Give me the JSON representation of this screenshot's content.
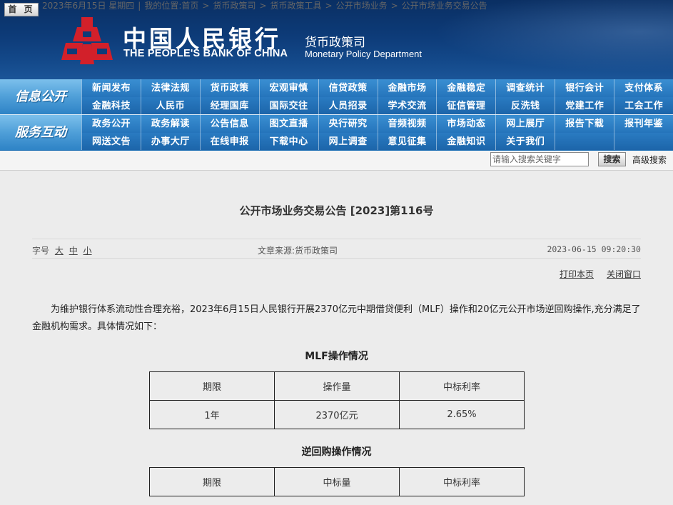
{
  "header": {
    "logo_cn": "中国人民银行",
    "logo_en": "THE PEOPLE'S BANK OF CHINA",
    "dept_cn": "货币政策司",
    "dept_en": "Monetary Policy Department",
    "colors": {
      "banner": "#0d3b78",
      "nav": "#2574bb",
      "emblem": "#d2202a"
    }
  },
  "nav": {
    "info_title": "信息公开",
    "service_title": "服务互动",
    "info_row1": [
      "新闻发布",
      "法律法规",
      "货币政策",
      "宏观审慎",
      "信贷政策",
      "金融市场",
      "金融稳定",
      "调查统计",
      "银行会计",
      "支付体系"
    ],
    "info_row2": [
      "金融科技",
      "人民币",
      "经理国库",
      "国际交往",
      "人员招录",
      "学术交流",
      "征信管理",
      "反洗钱",
      "党建工作",
      "工会工作"
    ],
    "service_row1": [
      "政务公开",
      "政务解读",
      "公告信息",
      "图文直播",
      "央行研究",
      "音频视频",
      "市场动态",
      "网上展厅",
      "报告下载",
      "报刊年鉴"
    ],
    "service_row2": [
      "网送文告",
      "办事大厅",
      "在线申报",
      "下载中心",
      "网上调查",
      "意见征集",
      "金融知识",
      "关于我们"
    ]
  },
  "crumbbar": {
    "home": "首 页",
    "date": "2023年6月15日 星期四",
    "location_label": "我的位置:",
    "crumbs": [
      "首页",
      "货币政策司",
      "货币政策工具",
      "公开市场业务",
      "公开市场业务交易公告"
    ],
    "search_placeholder": "请输入搜索关键字",
    "search_button": "搜索",
    "advanced_search": "高级搜索"
  },
  "article": {
    "title": "公开市场业务交易公告 [2023]第116号",
    "font_label": "字号",
    "font_sizes": [
      "大",
      "中",
      "小"
    ],
    "source": "文章来源:货币政策司",
    "time": "2023-06-15 09:20:30",
    "print": "打印本页",
    "close": "关闭窗口",
    "paragraph": "为维护银行体系流动性合理充裕，2023年6月15日人民银行开展2370亿元中期借贷便利（MLF）操作和20亿元公开市场逆回购操作,充分满足了金融机构需求。具体情况如下：",
    "mlf_caption": "MLF操作情况",
    "mlf_headers": [
      "期限",
      "操作量",
      "中标利率"
    ],
    "mlf_rows": [
      [
        "1年",
        "2370亿元",
        "2.65%"
      ]
    ],
    "rr_caption": "逆回购操作情况",
    "rr_headers": [
      "期限",
      "中标量",
      "中标利率"
    ]
  }
}
